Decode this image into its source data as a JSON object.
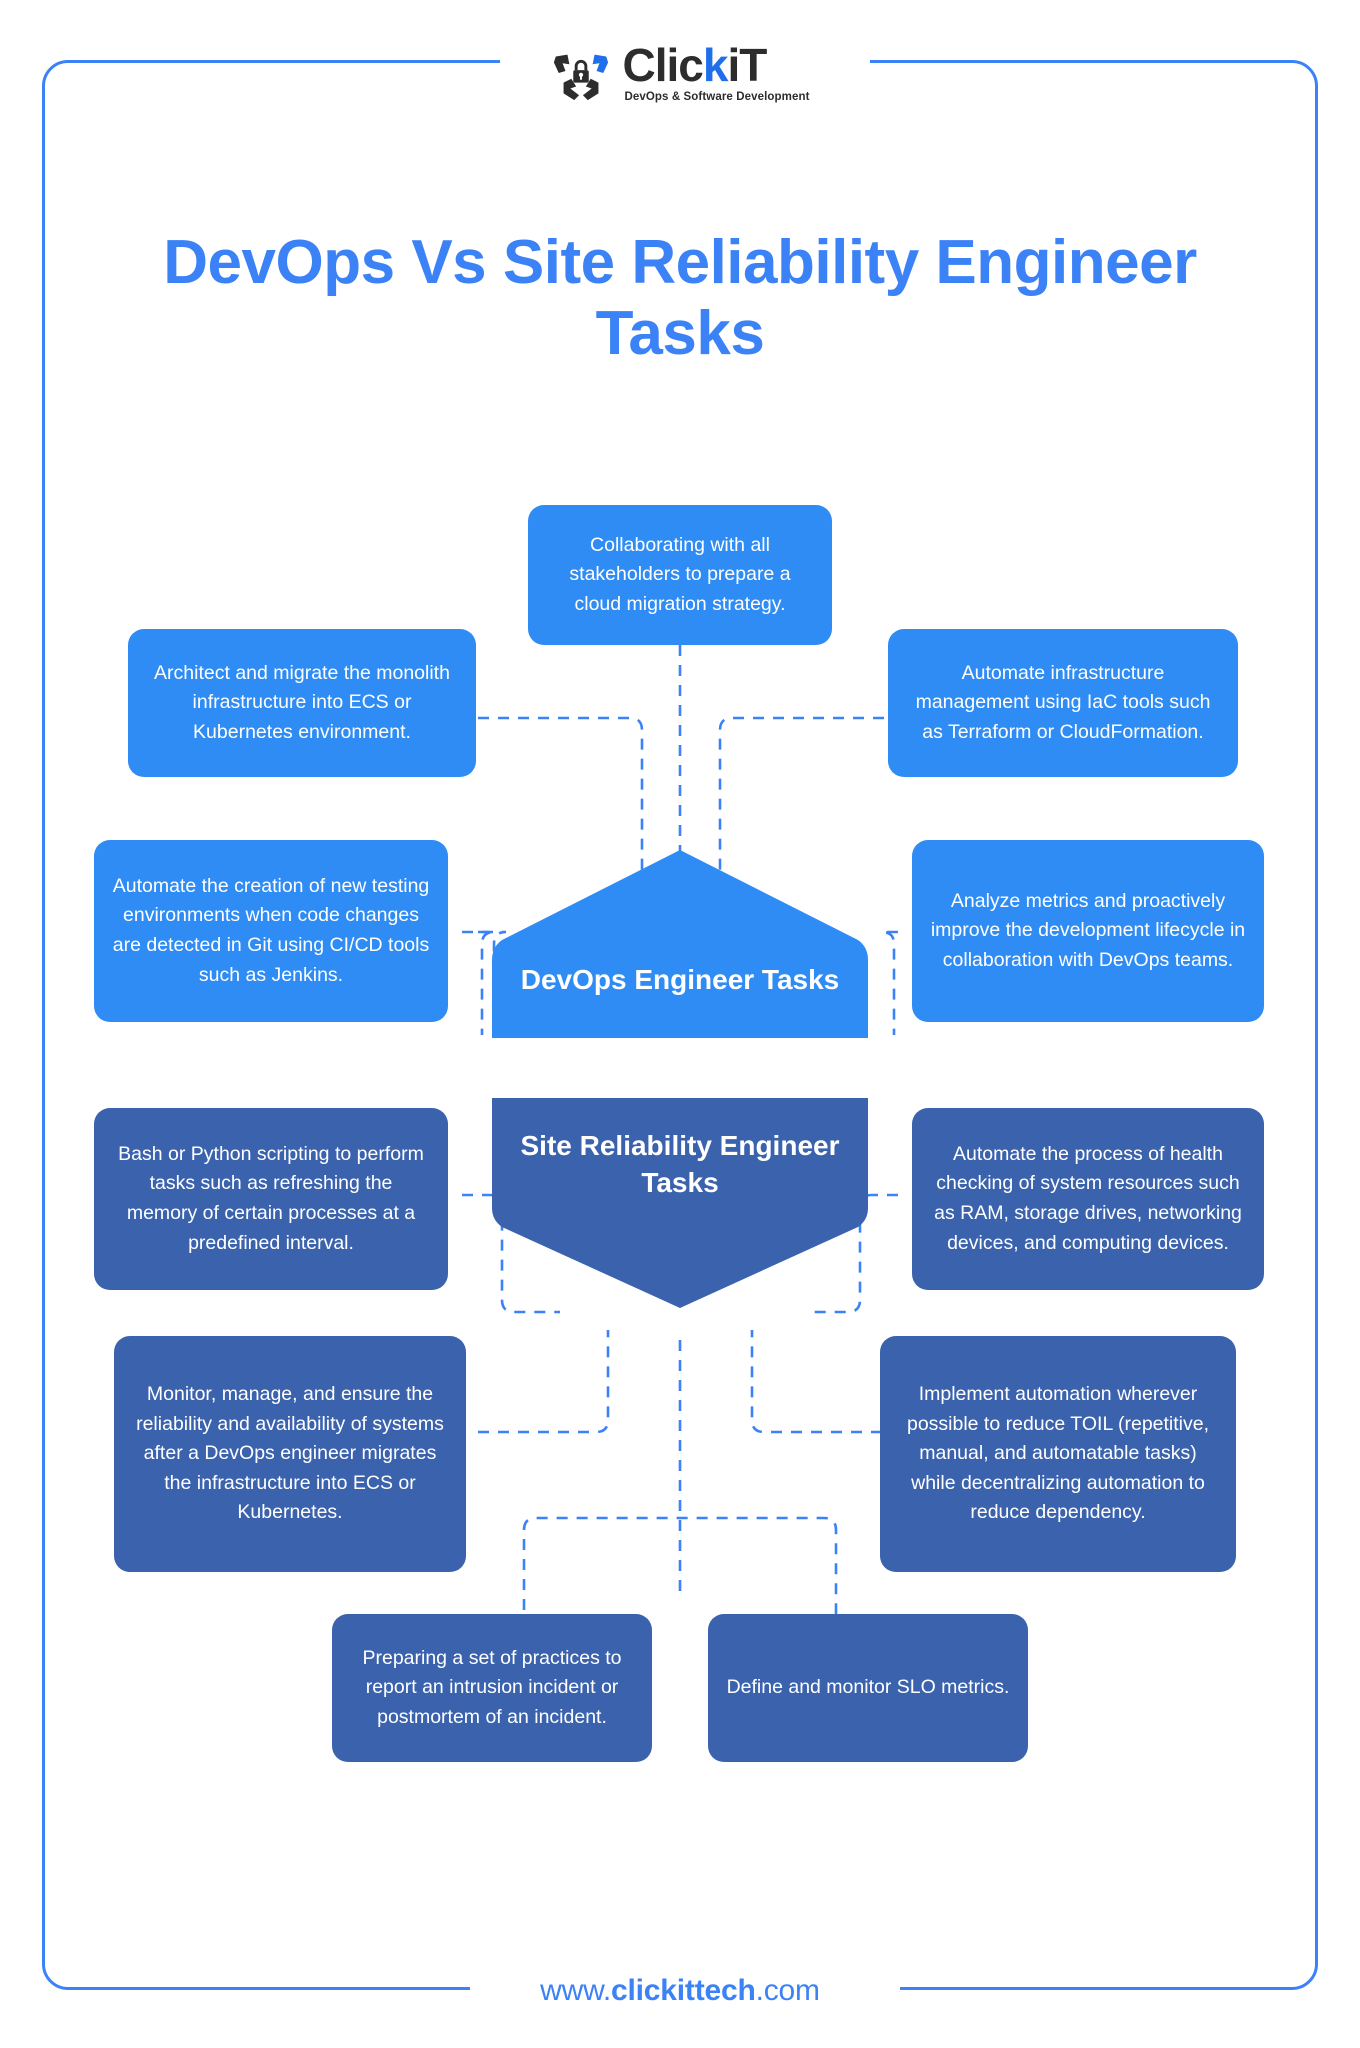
{
  "brand": {
    "logo_icon": "clickit-shield-lock-icon",
    "name_part1": "Clic",
    "name_part2": "k",
    "name_part3": "iT",
    "tagline": "DevOps & Software Development",
    "accent_color": "#3b82f6",
    "dark_color": "#2d2d2d"
  },
  "page_title": "DevOps Vs Site Reliability Engineer Tasks",
  "sections": [
    {
      "id": "devops",
      "center_label": "DevOps Engineer Tasks",
      "color": "#2f8cf5",
      "tasks": [
        "Collaborating with all stakeholders to prepare a cloud migration strategy.",
        "Architect and migrate the monolith infrastructure into ECS or Kubernetes environment.",
        "Automate infrastructure management using IaC tools such as Terraform or CloudFormation.",
        "Automate the creation of new testing environments when code changes are detected in Git using CI/CD tools such as Jenkins.",
        "Analyze metrics and proactively improve the development lifecycle in collaboration with DevOps teams."
      ]
    },
    {
      "id": "sre",
      "center_label": "Site Reliability Engineer Tasks",
      "color": "#3b62ad",
      "tasks": [
        "Bash or Python scripting to perform tasks such as refreshing the memory of certain processes at a predefined interval.",
        "Automate the process of health checking of system resources such as RAM, storage drives, networking devices, and computing devices.",
        "Monitor, manage, and ensure the reliability and availability of systems after a DevOps engineer migrates the infrastructure into ECS or Kubernetes.",
        "Implement automation wherever possible to reduce TOIL (repetitive, manual, and automatable tasks) while decentralizing automation to reduce dependency.",
        "Preparing a set of practices to report an intrusion incident or postmortem of an incident.",
        "Define and monitor SLO metrics."
      ]
    }
  ],
  "footer": {
    "url_prefix": "www.",
    "url_brand": "clickittech",
    "url_suffix": ".com"
  }
}
